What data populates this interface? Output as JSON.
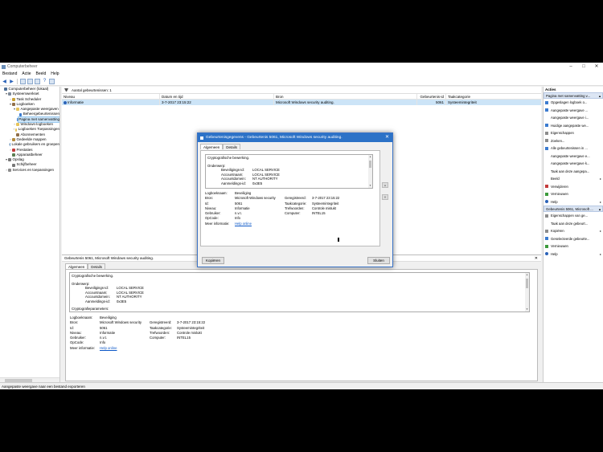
{
  "window": {
    "title": "Computerbeheer"
  },
  "menu": [
    "Bestand",
    "Actie",
    "Beeld",
    "Help"
  ],
  "tree": [
    {
      "label": "Computerbeheer (lokaal)",
      "level": 0,
      "exp": "",
      "icon": "computer-icon",
      "cls": "i-pc"
    },
    {
      "label": "Systeemwerkset",
      "level": 1,
      "exp": "▾",
      "icon": "tools-icon",
      "cls": "i-tool"
    },
    {
      "label": "Task Scheduler",
      "level": 2,
      "exp": "›",
      "icon": "task-scheduler-icon",
      "cls": "i-task"
    },
    {
      "label": "Logboeken",
      "level": 2,
      "exp": "▾",
      "icon": "event-log-icon",
      "cls": "i-log"
    },
    {
      "label": "Aangepaste weergaven",
      "level": 3,
      "exp": "▾",
      "icon": "folder-icon",
      "cls": "i-folder"
    },
    {
      "label": "Beheergebeurtenissen",
      "level": 4,
      "exp": "",
      "icon": "filter-icon",
      "cls": "i-filter"
    },
    {
      "label": "Pagina met samenvatting",
      "level": 4,
      "exp": "",
      "icon": "filter-icon",
      "cls": "i-filter",
      "selected": true
    },
    {
      "label": "Windows-logboeken",
      "level": 3,
      "exp": "›",
      "icon": "folder-icon",
      "cls": "i-folder"
    },
    {
      "label": "Logboeken Toepassingen",
      "level": 3,
      "exp": "›",
      "icon": "folder-icon",
      "cls": "i-folder"
    },
    {
      "label": "Abonnementen",
      "level": 3,
      "exp": "",
      "icon": "subscription-icon",
      "cls": "i-log"
    },
    {
      "label": "Gedeelde mappen",
      "level": 2,
      "exp": "›",
      "icon": "shared-folder-icon",
      "cls": "i-share"
    },
    {
      "label": "Lokale gebruikers en groepen",
      "level": 2,
      "exp": "›",
      "icon": "users-icon",
      "cls": "i-user"
    },
    {
      "label": "Prestaties",
      "level": 2,
      "exp": "›",
      "icon": "performance-icon",
      "cls": "i-perf"
    },
    {
      "label": "Apparaatbeheer",
      "level": 2,
      "exp": "",
      "icon": "device-manager-icon",
      "cls": "i-dev"
    },
    {
      "label": "Opslag",
      "level": 1,
      "exp": "▾",
      "icon": "storage-icon",
      "cls": "i-disk"
    },
    {
      "label": "Schijfbeheer",
      "level": 2,
      "exp": "",
      "icon": "disk-icon",
      "cls": "i-disk"
    },
    {
      "label": "Services en toepassingen",
      "level": 1,
      "exp": "›",
      "icon": "services-icon",
      "cls": "i-svc"
    }
  ],
  "filter": {
    "text": "Aantal gebeurtenissen: 1"
  },
  "grid": {
    "columns": [
      "Niveau",
      "Datum en tijd",
      "Bron",
      "Gebeurtenis-id",
      "Taakcategorie"
    ],
    "rows": [
      [
        "Informatie",
        "3-7-2017 23:15:22",
        "Microsoft Windows security auditing.",
        "5061",
        "Systeemintegriteit"
      ]
    ]
  },
  "detail": {
    "header": "Gebeurtenis 5061, Microsoft Windows security auditing.",
    "tabs": [
      "Algemeen",
      "Details"
    ],
    "description": {
      "title": "Cryptografische bewerking.",
      "section": "Onderwerp:",
      "pairs": [
        [
          "Beveiligings-id:",
          "LOCAL SERVICE"
        ],
        [
          "Accountnaam:",
          "LOCAL SERVICE"
        ],
        [
          "Accountdomein:",
          "NT AUTHORITY"
        ],
        [
          "Aanmeldings-id:",
          "0x3E5"
        ]
      ],
      "more": "Cryptografieparameters:"
    },
    "props": {
      "logname_label": "Logboeknaam:",
      "logname": "Beveiliging",
      "source_label": "Bron:",
      "source": "Microsoft Windows security",
      "logged_label": "Geregistreerd:",
      "logged": "3-7-2017 23:15:22",
      "id_label": "Id:",
      "id": "5061",
      "task_label": "Taakcategorie:",
      "task": "Systeemintegriteit",
      "level_label": "Niveau:",
      "level": "Informatie",
      "keywords_label": "Trefwoorden:",
      "keywords": "Controle mislukt",
      "user_label": "Gebruiker:",
      "user": "n.v.t.",
      "computer_label": "Computer:",
      "computer": "INTEL15",
      "opcode_label": "OpCode:",
      "opcode": "Info",
      "moreinfo_label": "Meer informatie:",
      "moreinfo": "Help online"
    }
  },
  "dialog": {
    "title": "Gebeurtenisgegevens - Gebeurtenis 5061, Microsoft Windows security auditing.",
    "copy": "Kopiëren",
    "close": "Sluiten"
  },
  "actions": {
    "title": "Acties",
    "section1": "Pagina met samenvatting v...",
    "items1": [
      {
        "label": "Opgeslagen logboek o...",
        "icon": "open-log-icon",
        "cls": "ai-blue"
      },
      {
        "label": "Aangepaste weergave ...",
        "icon": "filter-icon",
        "cls": "ai-blue"
      },
      {
        "label": "Aangepaste weergave i...",
        "icon": "import-icon",
        "cls": "ai-blank"
      },
      {
        "label": "Huidige aangepaste we...",
        "icon": "filter-icon",
        "cls": "ai-blue"
      },
      {
        "label": "Eigenschappen",
        "icon": "properties-icon",
        "cls": "ai-grey"
      },
      {
        "label": "Zoeken...",
        "icon": "search-icon",
        "cls": "ai-grey"
      },
      {
        "label": "Alle gebeurtenissen in ...",
        "icon": "save-icon",
        "cls": "ai-blue"
      },
      {
        "label": "Aangepaste weergave e...",
        "icon": "export-icon",
        "cls": "ai-blank"
      },
      {
        "label": "Aangepaste weergave k...",
        "icon": "copy-icon",
        "cls": "ai-blank"
      },
      {
        "label": "Taak aan deze aangepa...",
        "icon": "task-icon",
        "cls": "ai-blank"
      },
      {
        "label": "Beeld",
        "icon": "view-icon",
        "cls": "ai-blank",
        "arrow": true
      },
      {
        "label": "Verwijderen",
        "icon": "delete-icon",
        "cls": "ai-red"
      },
      {
        "label": "Vernieuwen",
        "icon": "refresh-icon",
        "cls": "ai-green"
      },
      {
        "label": "Help",
        "icon": "help-icon",
        "cls": "ai-help",
        "arrow": true
      }
    ],
    "section2": "Gebeurtenis 5061, Microsoft ...",
    "items2": [
      {
        "label": "Eigenschappen van ge...",
        "icon": "event-properties-icon",
        "cls": "ai-grey"
      },
      {
        "label": "Taak aan deze gebeurt...",
        "icon": "task-icon",
        "cls": "ai-blank"
      },
      {
        "label": "Kopiëren",
        "icon": "copy-icon",
        "cls": "ai-grey",
        "arrow": true
      },
      {
        "label": "Geselecteerde gebeurte...",
        "icon": "save-icon",
        "cls": "ai-blue"
      },
      {
        "label": "Vernieuwen",
        "icon": "refresh-icon",
        "cls": "ai-green"
      },
      {
        "label": "Help",
        "icon": "help-icon",
        "cls": "ai-help",
        "arrow": true
      }
    ]
  },
  "status": {
    "text": "Aangepaste weergave naar een bestand exporteren"
  }
}
